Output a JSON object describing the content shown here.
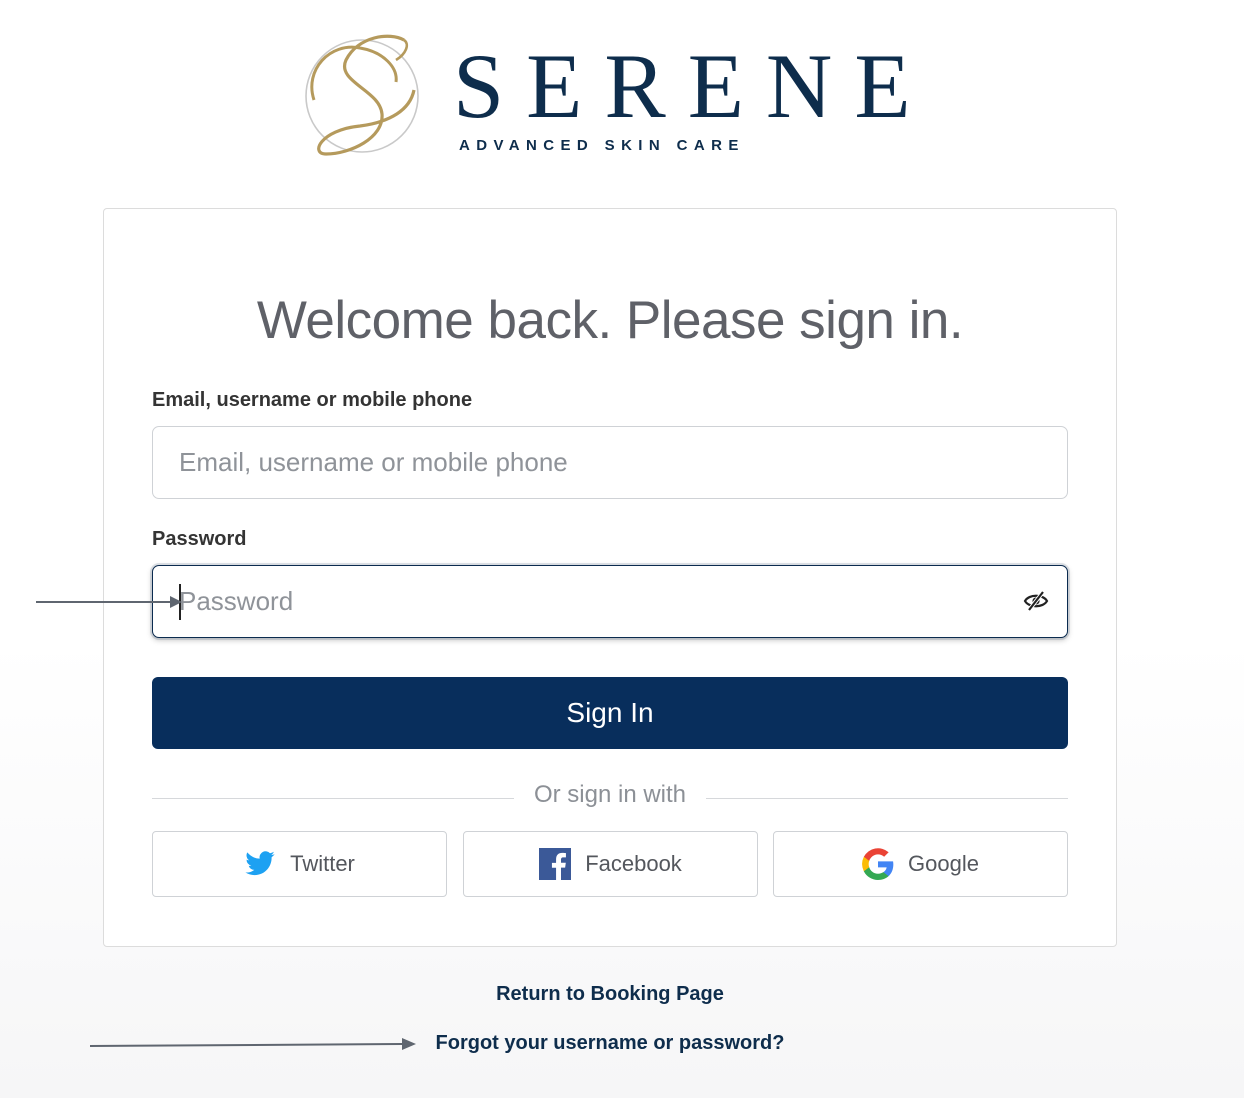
{
  "brand": {
    "name": "SERENE",
    "tagline": "ADVANCED SKIN CARE",
    "colors": {
      "navy": "#0e2d4c",
      "gold": "#b59a5c"
    }
  },
  "form": {
    "heading": "Welcome back. Please sign in.",
    "email_label": "Email, username or mobile phone",
    "email_placeholder": "Email, username or mobile phone",
    "password_label": "Password",
    "password_placeholder": "Password",
    "sign_in_label": "Sign In"
  },
  "social": {
    "divider_text": "Or sign in with",
    "buttons": [
      {
        "label": "Twitter",
        "icon": "twitter-icon"
      },
      {
        "label": "Facebook",
        "icon": "facebook-icon"
      },
      {
        "label": "Google",
        "icon": "google-icon"
      }
    ]
  },
  "links": {
    "return": "Return to Booking Page",
    "forgot": "Forgot your username or password?"
  },
  "theme": {
    "button_bg": "#082e5c",
    "text_muted": "#8c9096"
  }
}
